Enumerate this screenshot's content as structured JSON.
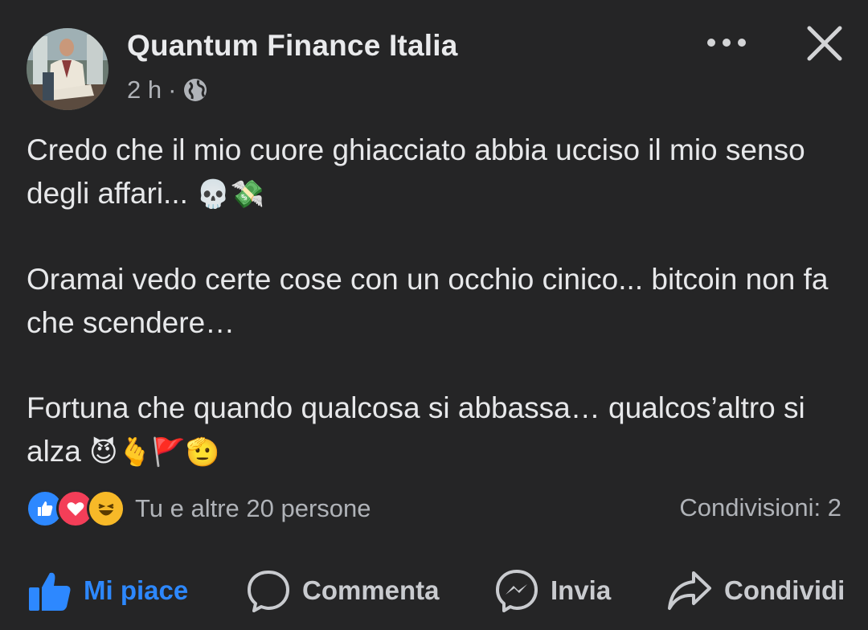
{
  "post": {
    "author": "Quantum Finance Italia",
    "time": "2 h",
    "dot": "·",
    "paragraphs": [
      {
        "text": "Credo che il mio cuore ghiacciato abbia ucciso il mio senso degli affari... ",
        "emoji": "💀💸"
      },
      {
        "text": "Oramai vedo certe cose con un occhio cinico... bitcoin non fa che scendere…",
        "emoji": ""
      },
      {
        "text": "Fortuna che quando qualcosa si abbassa… qualcos’altro si alza ",
        "emoji": "😈🫰🚩🫡"
      }
    ]
  },
  "reactions": {
    "icons": [
      "like-icon",
      "love-icon",
      "haha-icon"
    ],
    "summary": "Tu e altre 20 persone",
    "shares": "Condivisioni: 2"
  },
  "actions": {
    "like": "Mi piace",
    "comment": "Commenta",
    "send": "Invia",
    "share": "Condividi"
  },
  "colors": {
    "background": "#252526",
    "accent": "#2d88ff",
    "text": "#e4e6eb",
    "secondary": "#b0b3b8"
  }
}
